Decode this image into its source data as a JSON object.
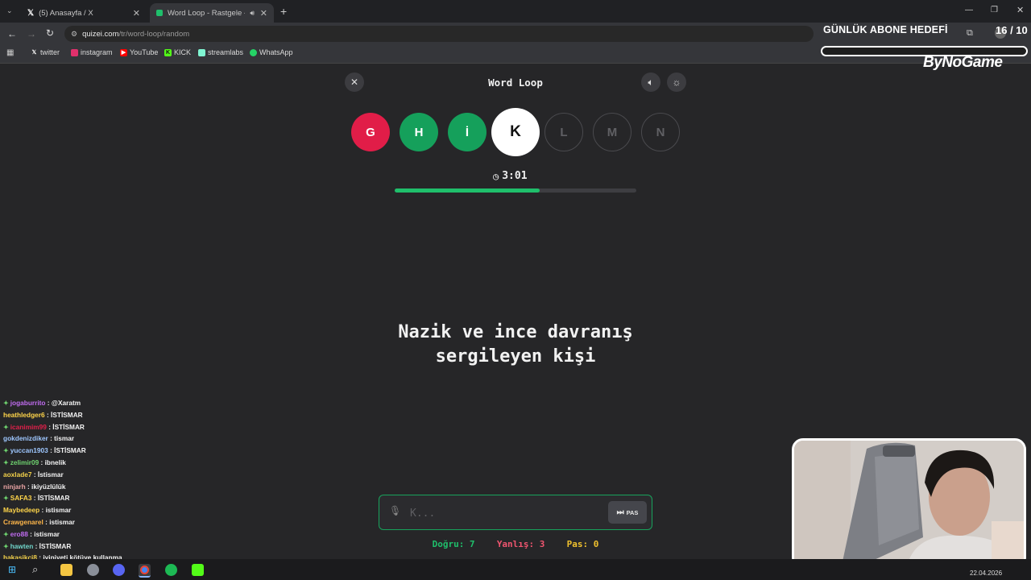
{
  "browser": {
    "tabs": [
      {
        "title": "(5) Anasayfa / X",
        "favicon": "x-logo-icon",
        "close": "✕"
      },
      {
        "title": "Word Loop - Rastgele - Qu",
        "favicon": "quizei-icon",
        "close": "✕"
      }
    ],
    "new_tab": "+",
    "url": {
      "host": "quizei.com",
      "path": "/tr/word-loop/random"
    },
    "bookmarks": [
      {
        "label": "twitter",
        "icon": "x-logo-icon",
        "color": "#ffffff"
      },
      {
        "label": "instagram",
        "icon": "instagram-icon",
        "color": "#e1306c"
      },
      {
        "label": "YouTube",
        "icon": "youtube-icon",
        "color": "#ff0000"
      },
      {
        "label": "KICK",
        "icon": "kick-icon",
        "color": "#53fc18"
      },
      {
        "label": "streamlabs",
        "icon": "streamlabs-icon",
        "color": "#80f5d2"
      },
      {
        "label": "WhatsApp",
        "icon": "whatsapp-icon",
        "color": "#25d366"
      }
    ]
  },
  "overlay": {
    "sub_goal_label": "GÜNLÜK ABONE HEDEFİ",
    "sub_goal_count": "16 / 10",
    "brand": "ByNoGame"
  },
  "game": {
    "title": "Word Loop",
    "close_icon": "✕",
    "letters": [
      {
        "char": "G",
        "state": "wrong"
      },
      {
        "char": "H",
        "state": "correct"
      },
      {
        "char": "İ",
        "state": "correct"
      },
      {
        "char": "K",
        "state": "current"
      },
      {
        "char": "L",
        "state": "pending"
      },
      {
        "char": "M",
        "state": "pending"
      },
      {
        "char": "N",
        "state": "pending"
      }
    ],
    "timer": "3:01",
    "time_progress": 0.6,
    "clue_line1": "Nazik ve ince davranış",
    "clue_line2": "sergileyen kişi",
    "input_placeholder": "K...",
    "pass_label": "PAS",
    "stats": {
      "correct": "Doğru: 7",
      "wrong": "Yanlış: 3",
      "pass": "Pas: 0"
    },
    "colors": {
      "correct": "#15a05b",
      "wrong": "#e11d48",
      "accent": "#1fbf6b"
    }
  },
  "chat": [
    {
      "user": "jogaburrito",
      "msg": "@Xaratm",
      "color": "#c06cf0",
      "badge": true
    },
    {
      "user": "heathledger6",
      "msg": "İSTİSMAR",
      "color": "#ffd54a",
      "badge": false
    },
    {
      "user": "icanimim99",
      "msg": "İSTİSMAR",
      "color": "#e0204a",
      "badge": true
    },
    {
      "user": "gokdenizdiker",
      "msg": "tismar",
      "color": "#9ec7ff",
      "badge": false
    },
    {
      "user": "yuccan1903",
      "msg": "İSTİSMAR",
      "color": "#9ec7ff",
      "badge": true
    },
    {
      "user": "zelimir09",
      "msg": "ibnelik",
      "color": "#6fd36f",
      "badge": true
    },
    {
      "user": "aoxlade7",
      "msg": "İstismar",
      "color": "#f2d04a",
      "badge": false
    },
    {
      "user": "ninjarh",
      "msg": "ikiyüzlülük",
      "color": "#e8a3a3",
      "badge": false
    },
    {
      "user": "SAFA3",
      "msg": "İSTİSMAR",
      "color": "#ffd54a",
      "badge": true
    },
    {
      "user": "Maybedeep",
      "msg": "istismar",
      "color": "#ffd54a",
      "badge": false
    },
    {
      "user": "Crawgenarel",
      "msg": "istismar",
      "color": "#ffb74a",
      "badge": false
    },
    {
      "user": "ero88",
      "msg": "istismar",
      "color": "#c06cf0",
      "badge": true
    },
    {
      "user": "hawten",
      "msg": "İSTİSMAR",
      "color": "#6fd3c8",
      "badge": true
    },
    {
      "user": "hakasikci8",
      "msg": "iyiniyeti kötüye kullanma",
      "color": "#f2d04a",
      "badge": false
    }
  ],
  "taskbar": {
    "date": "22.04.2026"
  }
}
